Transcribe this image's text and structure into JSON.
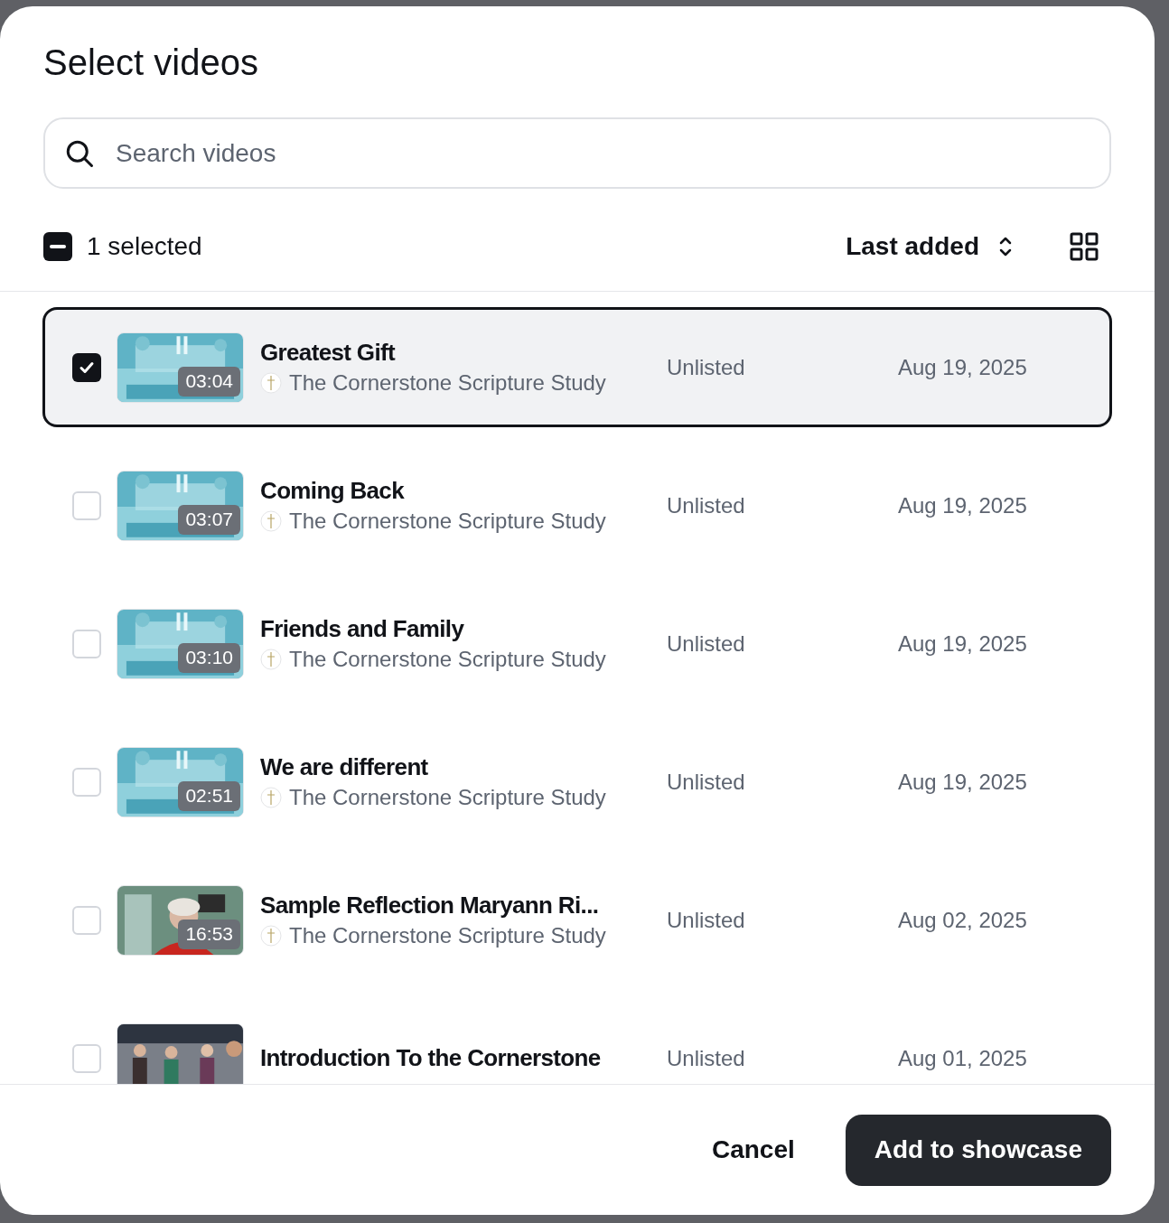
{
  "dialog": {
    "title": "Select videos"
  },
  "search": {
    "placeholder": "Search videos"
  },
  "toolbar": {
    "indeterminate": true,
    "selected_label": "1 selected",
    "sort_label": "Last added"
  },
  "videos": [
    {
      "title": "Greatest Gift",
      "channel": "The Cornerstone Scripture Study",
      "duration": "03:04",
      "visibility": "Unlisted",
      "date": "Aug 19, 2025",
      "selected": true
    },
    {
      "title": "Coming Back",
      "channel": "The Cornerstone Scripture Study",
      "duration": "03:07",
      "visibility": "Unlisted",
      "date": "Aug 19, 2025",
      "selected": false
    },
    {
      "title": "Friends and Family",
      "channel": "The Cornerstone Scripture Study",
      "duration": "03:10",
      "visibility": "Unlisted",
      "date": "Aug 19, 2025",
      "selected": false
    },
    {
      "title": "We are different",
      "channel": "The Cornerstone Scripture Study",
      "duration": "02:51",
      "visibility": "Unlisted",
      "date": "Aug 19, 2025",
      "selected": false
    },
    {
      "title": "Sample Reflection Maryann Ri...",
      "channel": "The Cornerstone Scripture Study",
      "duration": "16:53",
      "visibility": "Unlisted",
      "date": "Aug 02, 2025",
      "selected": false
    },
    {
      "title": "Introduction To the Cornerstone",
      "visibility": "Unlisted",
      "date": "Aug 01, 2025",
      "selected": false
    }
  ],
  "buttons": {
    "cancel": "Cancel",
    "confirm": "Add to showcase"
  }
}
